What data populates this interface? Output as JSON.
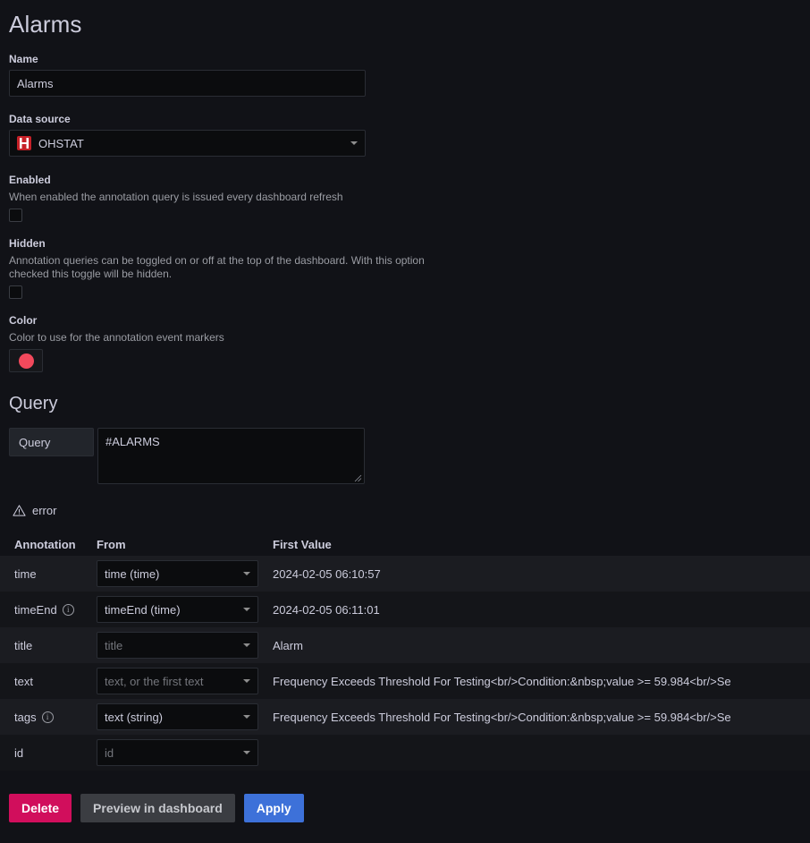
{
  "page": {
    "title": "Alarms"
  },
  "colors": {
    "accent_blue": "#3d71d9",
    "delete_pink": "#d10e5c",
    "annotation_marker": "#f2495c",
    "datasource_logo": "#c62128"
  },
  "name_field": {
    "label": "Name",
    "value": "Alarms",
    "placeholder": "Name"
  },
  "datasource_field": {
    "label": "Data source",
    "value": "OHSTAT",
    "logo_name": "ohstat-logo"
  },
  "enabled_field": {
    "label": "Enabled",
    "description": "When enabled the annotation query is issued every dashboard refresh",
    "checked": false
  },
  "hidden_field": {
    "label": "Hidden",
    "description": "Annotation queries can be toggled on or off at the top of the dashboard. With this option checked this toggle will be hidden.",
    "checked": false
  },
  "color_field": {
    "label": "Color",
    "description": "Color to use for the annotation event markers",
    "value": "#f2495c"
  },
  "query_section": {
    "title": "Query",
    "query_label": "Query",
    "query_value": "#ALARMS",
    "error_text": "error"
  },
  "mapping_table": {
    "headers": [
      "Annotation",
      "From",
      "First Value"
    ],
    "rows": [
      {
        "annotation": "time",
        "has_info": false,
        "from": "time (time)",
        "from_is_placeholder": false,
        "first_value": "2024-02-05 06:10:57"
      },
      {
        "annotation": "timeEnd",
        "has_info": true,
        "from": "timeEnd (time)",
        "from_is_placeholder": false,
        "first_value": "2024-02-05 06:11:01"
      },
      {
        "annotation": "title",
        "has_info": false,
        "from": "title",
        "from_is_placeholder": true,
        "first_value": "Alarm"
      },
      {
        "annotation": "text",
        "has_info": false,
        "from": "text, or the first text",
        "from_is_placeholder": true,
        "first_value": "Frequency Exceeds Threshold For Testing<br/>Condition:&nbsp;value >= 59.984<br/>Se"
      },
      {
        "annotation": "tags",
        "has_info": true,
        "from": "text (string)",
        "from_is_placeholder": false,
        "first_value": "Frequency Exceeds Threshold For Testing<br/>Condition:&nbsp;value >= 59.984<br/>Se"
      },
      {
        "annotation": "id",
        "has_info": false,
        "from": "id",
        "from_is_placeholder": true,
        "first_value": ""
      }
    ]
  },
  "buttons": {
    "delete": "Delete",
    "preview": "Preview in dashboard",
    "apply": "Apply"
  }
}
